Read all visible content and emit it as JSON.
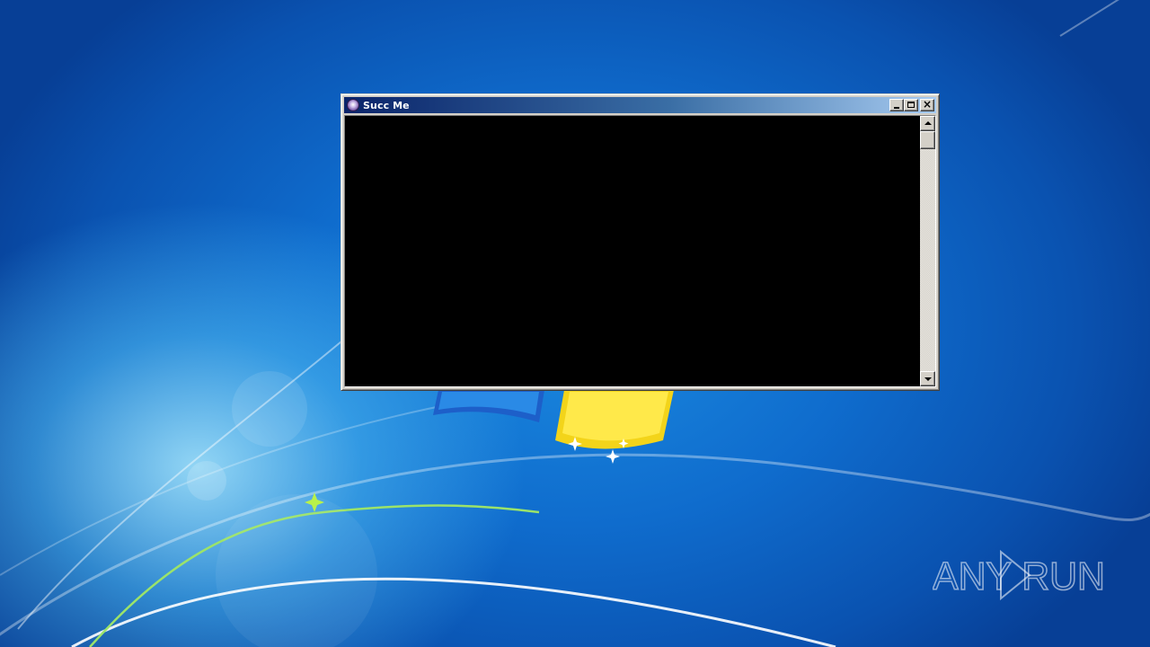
{
  "window": {
    "title": "Succ Me",
    "icon": "app-icon",
    "console_background": "#000000"
  },
  "caption_buttons": {
    "minimize_icon": "minimize-icon",
    "maximize_icon": "maximize-icon",
    "close_icon": "close-icon"
  },
  "scrollbar": {
    "up_icon": "scroll-up-arrow-icon",
    "down_icon": "scroll-down-arrow-icon"
  },
  "watermark": {
    "text": "ANY RUN"
  },
  "colors": {
    "titlebar_start": "#0a246a",
    "titlebar_end": "#a6caf0",
    "desktop_blue": "#0f6ccd"
  }
}
